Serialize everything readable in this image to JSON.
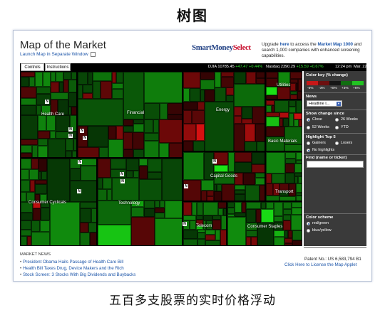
{
  "page_title": "树图",
  "caption": "五百多支股票的实时价格浮动",
  "app": {
    "title": "Map of the Market",
    "launch_link": "Launch Map in Separate Window",
    "logo_smart": "SmartMoney",
    "logo_select": "Select",
    "upgrade_pre": "Upgrade ",
    "upgrade_here": "here",
    "upgrade_mid": " to access the ",
    "upgrade_product": "Market Map 1000",
    "upgrade_post": " and search 1,000 companies with enhanced screening capabilities."
  },
  "tabs": [
    {
      "label": "Controls"
    },
    {
      "label": "Instructions"
    }
  ],
  "ticker": {
    "djia": "DJIA 10785.45",
    "djia_change": "+47.47 +0.44%",
    "nasdaq": "Nasdaq 2390.29",
    "nasdaq_change": "+15.59 +0.67%",
    "time": "12:24 pm",
    "date": "Mar. 22"
  },
  "map": {
    "sectors": [
      {
        "label": "Health Care"
      },
      {
        "label": "Financial"
      },
      {
        "label": "Energy"
      },
      {
        "label": "Utilities"
      },
      {
        "label": "Basic Materials"
      },
      {
        "label": "Capital Goods"
      },
      {
        "label": "Transport"
      },
      {
        "label": "Consumer Cyclicals"
      },
      {
        "label": "Technology"
      },
      {
        "label": "Telecom"
      },
      {
        "label": "Consumer Staples"
      }
    ],
    "news_badge": "N"
  },
  "panel": {
    "color_key_title": "Color key (% change)",
    "color_key_labels": [
      "-6%",
      "-3%",
      "+0%",
      "+3%",
      "+6%"
    ],
    "news_title": "News",
    "news_select_value": "Headline I...",
    "change_title": "Show change since",
    "change_options": [
      "Close",
      "26 Weeks",
      "52 Weeks",
      "YTD"
    ],
    "highlight_title": "Highlight Top 5",
    "highlight_options": [
      "Gainers",
      "Losers",
      "No highlights"
    ],
    "find_title": "Find (name or ticker)",
    "scheme_title": "Color scheme",
    "scheme_options": [
      "red/green",
      "blue/yellow"
    ]
  },
  "news": {
    "heading": "MARKET NEWS",
    "items": [
      "President Obama Hails Passage of Health Care Bill",
      "Health Bill Taxes Drug, Device Makers and the Rich",
      "Stock Screen: 3 Stocks With Big Dividends and Buybacks"
    ]
  },
  "footer": {
    "patent": "Patent No.: US 6,583,794 B1",
    "license_link": "Click Here to License the Map Applet"
  },
  "colors": {
    "dark_green": "#0f5410",
    "bright_green": "#22c322",
    "dark_red": "#5a0d0d",
    "bright_red": "#c81818",
    "panel_bg": "#3a3a3a"
  }
}
